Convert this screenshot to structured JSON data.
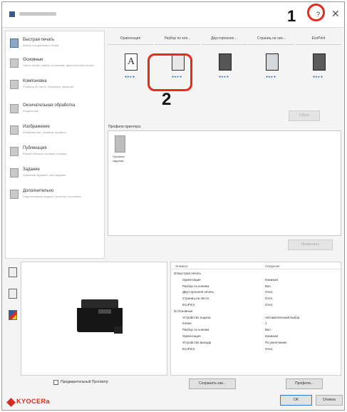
{
  "callouts": {
    "one": "1",
    "two": "2"
  },
  "window": {
    "help": "?",
    "close": "✕"
  },
  "sidebar": {
    "items": [
      {
        "title": "Быстрая печать",
        "sub": "Выбор специальных опций"
      },
      {
        "title": "Основные",
        "sub": "Число копий, разбор по копиям, двусторонняя печать"
      },
      {
        "title": "Компоновка",
        "sub": "Страниц на листе, брошюра, масштаб"
      },
      {
        "title": "Окончательная обработка",
        "sub": "Разделение"
      },
      {
        "title": "Изображение",
        "sub": "Изображение, графика, шрифты"
      },
      {
        "title": "Публикация",
        "sub": "Режим обложки, вставка страниц"
      },
      {
        "title": "Задание",
        "sub": "Хранение заданий, имя задания"
      },
      {
        "title": "Дополнительно",
        "sub": "Подключаемые модули, монитор состояния"
      }
    ]
  },
  "quickprint": {
    "tabs": [
      "Ориентация",
      "Разбор по коп...",
      "Двусторонняя ...",
      "Страниц на лис...",
      "EcoPrint"
    ],
    "orientation_glyph": "A",
    "dots": "●▸▸●",
    "reset": "Сброс"
  },
  "profiles": {
    "label": "Профили принтера:",
    "item": "Профиль задания..."
  },
  "apply": "Применить",
  "details": {
    "col_item": "Элемент",
    "col_info": "Сведения",
    "rows": [
      {
        "name": "⊟ Быстрая печать",
        "value": "",
        "indent": 0
      },
      {
        "name": "Ориентация",
        "value": "Книжная",
        "indent": 1
      },
      {
        "name": "Разбор по копиям",
        "value": "Вкл.",
        "indent": 1
      },
      {
        "name": "Двусторонняя печать",
        "value": "Откл.",
        "indent": 1
      },
      {
        "name": "Страниц на листе",
        "value": "Откл.",
        "indent": 1
      },
      {
        "name": "EcoPrint",
        "value": "Откл.",
        "indent": 1
      },
      {
        "name": "⊟ Основные",
        "value": "",
        "indent": 0
      },
      {
        "name": "Устройство подачи",
        "value": "Автоматический выбор",
        "indent": 1
      },
      {
        "name": "Копии",
        "value": "1",
        "indent": 1
      },
      {
        "name": "Разбор по копиям",
        "value": "Вкл.",
        "indent": 1
      },
      {
        "name": "Ориентация",
        "value": "Книжная",
        "indent": 1
      },
      {
        "name": "Устройство вывода",
        "value": "По умолчанию",
        "indent": 1
      },
      {
        "name": "EcoPrint",
        "value": "Откл.",
        "indent": 1
      }
    ]
  },
  "bottom": {
    "preview_checkbox": "Предварительный Просмотр",
    "save_as": "Сохранить как...",
    "profiles": "Профили..."
  },
  "footer": {
    "logo": "KYOCERa",
    "ok": "OK",
    "cancel": "Отмена"
  },
  "colors": {
    "accent": "#2b6cc4",
    "callout_ring": "#e8291c",
    "brand": "#d62d20"
  }
}
